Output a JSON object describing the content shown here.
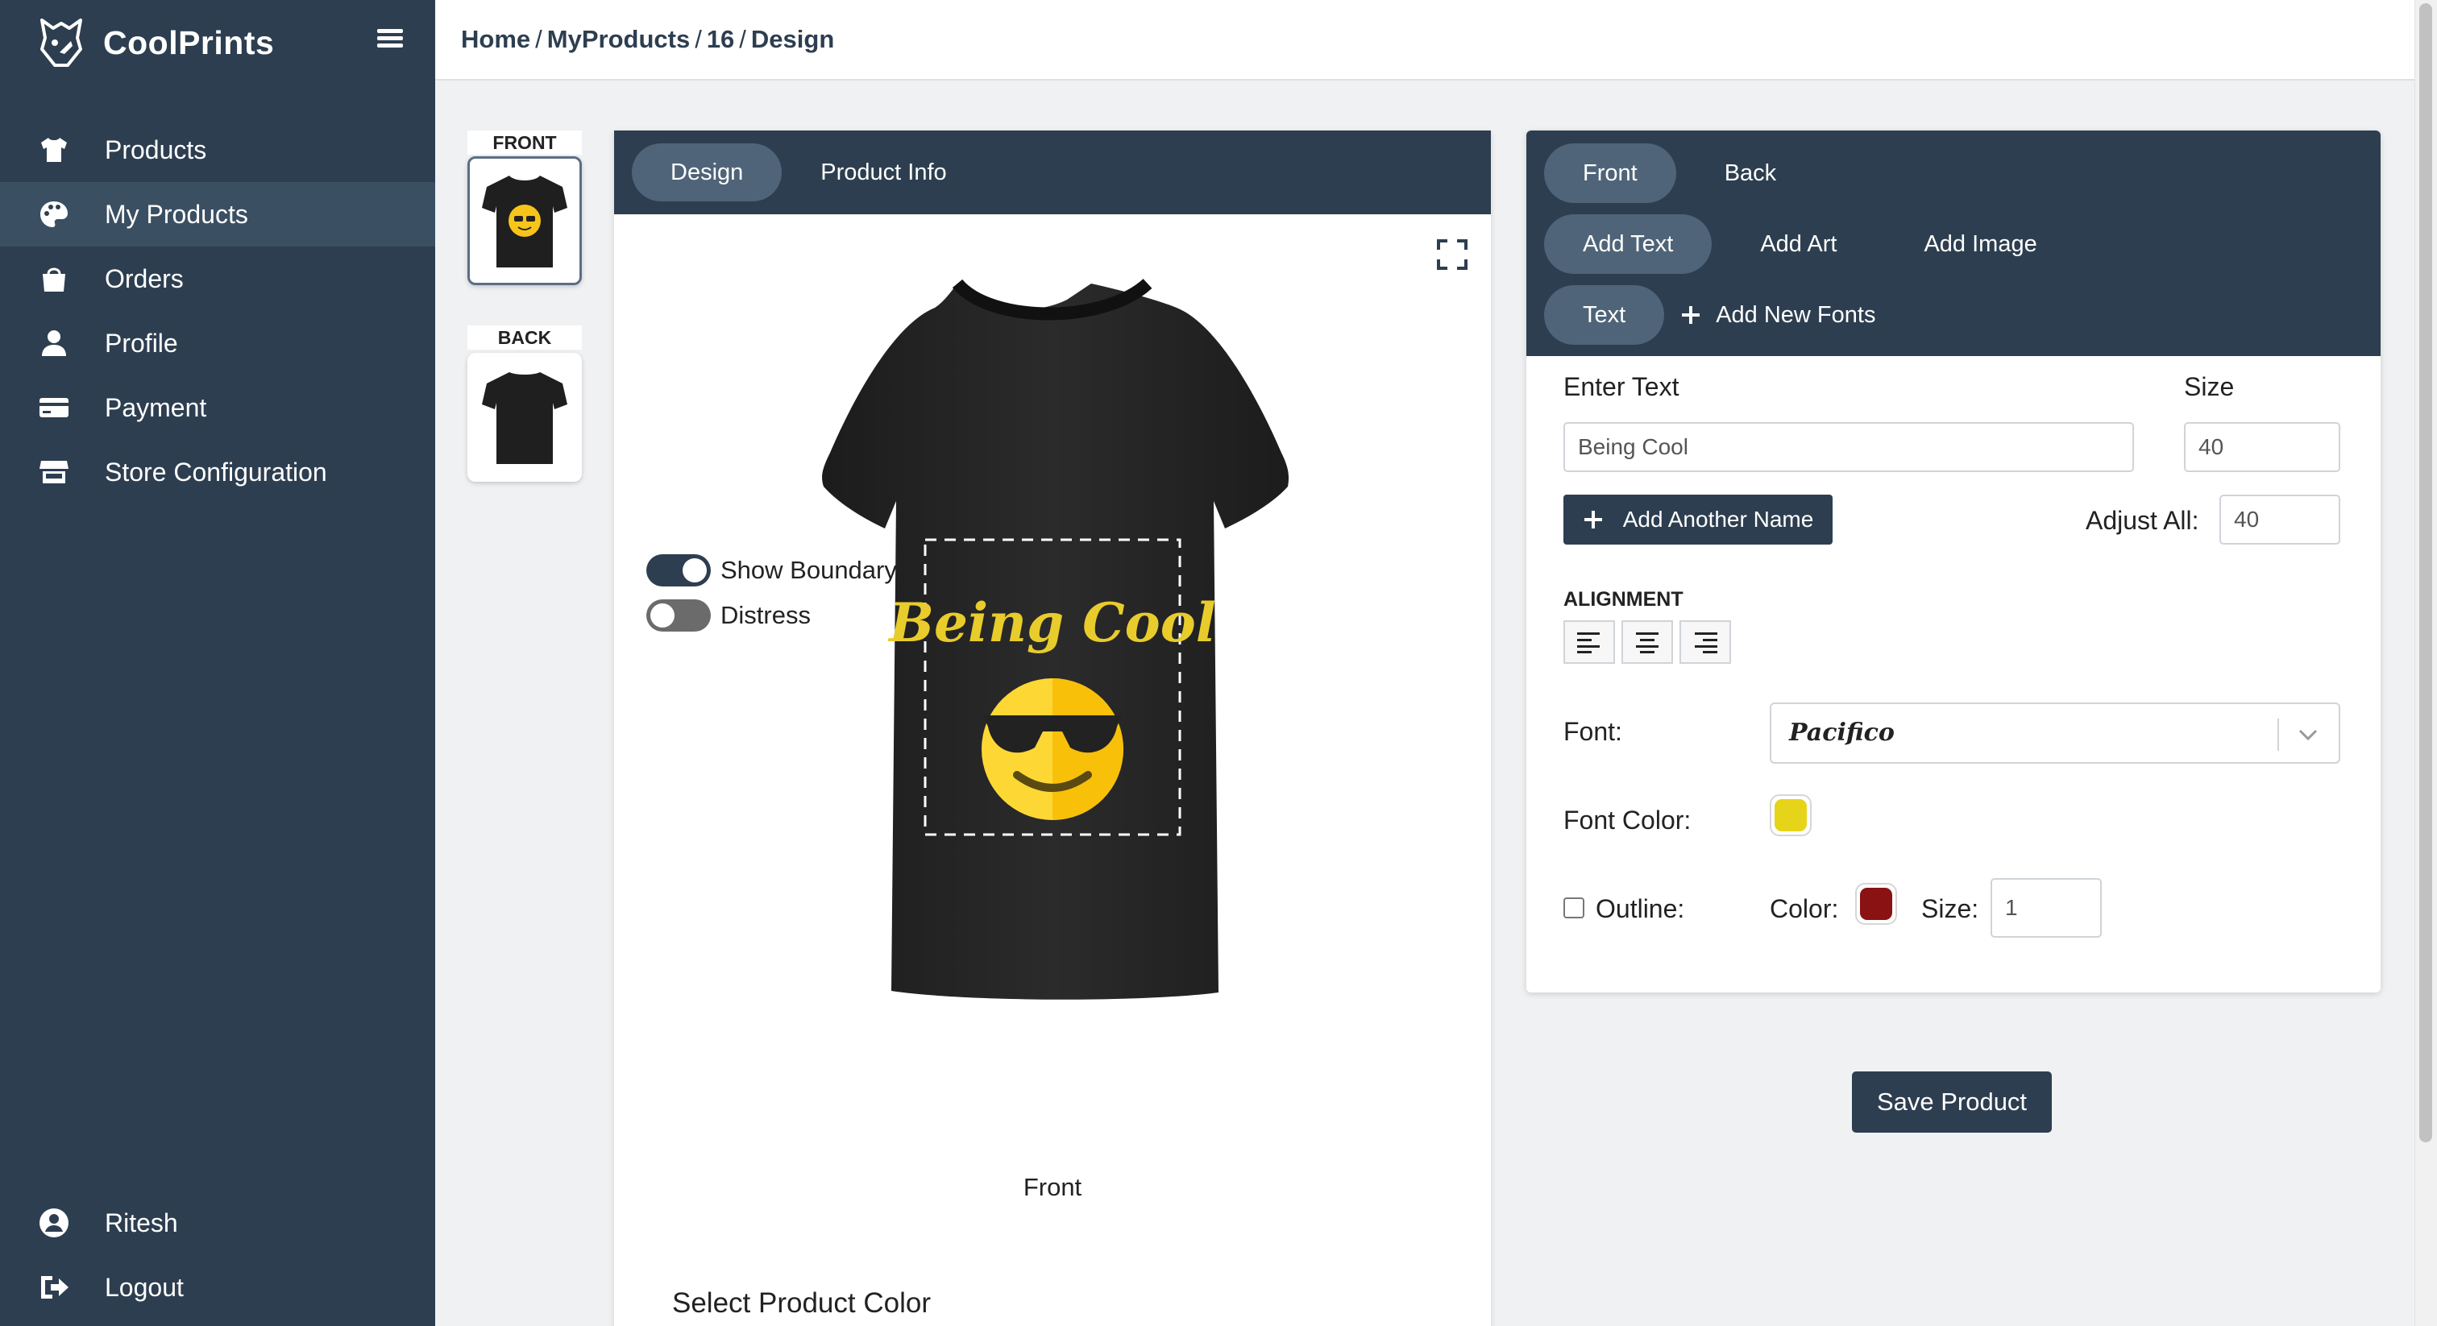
{
  "brand": {
    "name": "CoolPrints"
  },
  "sidebar": {
    "items": [
      {
        "label": "Products",
        "icon": "tshirt-icon"
      },
      {
        "label": "My Products",
        "icon": "palette-icon"
      },
      {
        "label": "Orders",
        "icon": "shopping-bag-icon"
      },
      {
        "label": "Profile",
        "icon": "user-icon"
      },
      {
        "label": "Payment",
        "icon": "credit-card-icon"
      },
      {
        "label": "Store Configuration",
        "icon": "store-icon"
      }
    ],
    "active_item": "My Products",
    "bottom": [
      {
        "label": "Ritesh",
        "icon": "user-circle-icon"
      },
      {
        "label": "Logout",
        "icon": "logout-icon"
      }
    ]
  },
  "breadcrumb": [
    "Home",
    "MyProducts",
    "16",
    "Design"
  ],
  "thumbnails": {
    "front_label": "FRONT",
    "back_label": "BACK"
  },
  "design_panel": {
    "tabs": [
      "Design",
      "Product Info"
    ],
    "active_tab": "Design",
    "design_text": "Being Cool",
    "toggles": {
      "show_boundary": {
        "label": "Show Boundary",
        "on": true
      },
      "distress": {
        "label": "Distress",
        "on": false
      }
    },
    "view_caption": "Front",
    "select_color_title": "Select Product Color"
  },
  "text_panel": {
    "side_tabs": [
      "Front",
      "Back"
    ],
    "active_side": "Front",
    "add_tabs": [
      "Add Text",
      "Add Art",
      "Add Image"
    ],
    "active_add": "Add Text",
    "sub_tabs": {
      "text": "Text",
      "add_fonts": "Add New Fonts"
    },
    "enter_text_label": "Enter Text",
    "enter_text_value": "Being Cool",
    "size_label": "Size",
    "size_value": "40",
    "add_another_name": "Add Another Name",
    "adjust_all_label": "Adjust All:",
    "adjust_all_value": "40",
    "alignment_label": "ALIGNMENT",
    "font_label": "Font:",
    "font_value": "Pacifico",
    "font_color_label": "Font Color:",
    "font_color": "#e6d41a",
    "outline_label": "Outline:",
    "outline_checked": false,
    "outline_color_label": "Color:",
    "outline_color": "#8b1212",
    "outline_size_label": "Size:",
    "outline_size_value": "1"
  },
  "save_button": "Save Product",
  "colors": {
    "sidebar": "#2d3e50",
    "accent": "#4f6478",
    "text_yellow": "#e8cc2c"
  }
}
